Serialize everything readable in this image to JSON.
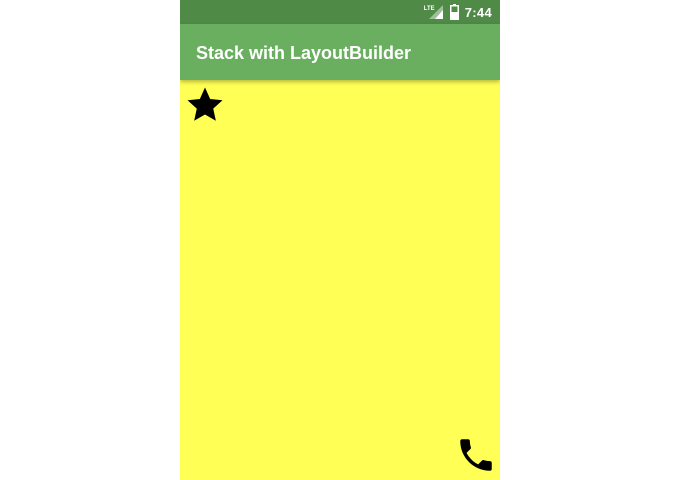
{
  "status_bar": {
    "network_label": "LTE",
    "time": "7:44",
    "icons": [
      "signal-icon",
      "battery-icon"
    ]
  },
  "app_bar": {
    "title": "Stack with LayoutBuilder"
  },
  "content": {
    "icons": [
      "star-icon",
      "phone-icon"
    ]
  },
  "colors": {
    "status_bar": "#4f8a47",
    "app_bar": "#6aaf5f",
    "background": "#ffff55",
    "icon": "#000000"
  }
}
